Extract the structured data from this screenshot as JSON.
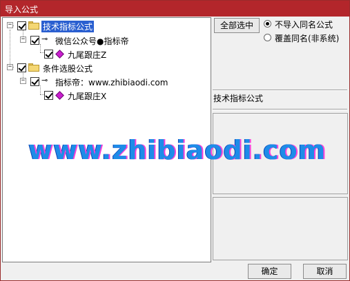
{
  "window": {
    "title": "导入公式"
  },
  "tree": {
    "nodes": [
      {
        "label": "技术指标公式",
        "icon": "folder-icon",
        "checked": true,
        "expanded": true,
        "selected": true
      },
      {
        "label": "微信公众号●指标帝",
        "icon": "key-icon",
        "checked": true,
        "expanded": true
      },
      {
        "label": "九尾跟庄Z",
        "icon": "diamond-icon",
        "checked": true
      },
      {
        "label": "条件选股公式",
        "icon": "folder-icon",
        "checked": true,
        "expanded": true
      },
      {
        "label": "指标帝：www.zhibiaodi.com",
        "icon": "key-icon",
        "checked": true,
        "expanded": true
      },
      {
        "label": "九尾跟庄X",
        "icon": "diamond-icon",
        "checked": true
      }
    ]
  },
  "buttons": {
    "select_all": "全部选中",
    "ok": "确定",
    "cancel": "取消"
  },
  "options": {
    "no_import_same_name": "不导入同名公式",
    "overwrite_same_name": "覆盖同名(非系统)",
    "selected": "no_import_same_name"
  },
  "detail": {
    "type_label": "技术指标公式"
  },
  "watermark": "www.zhibiaodi.com",
  "colors": {
    "titlebar": "#b3262b",
    "selection": "#2a5fd0",
    "watermark": "#1e8ce8"
  }
}
